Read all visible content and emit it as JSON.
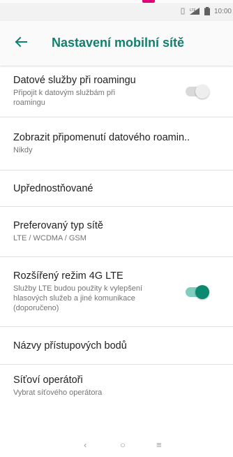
{
  "app": {
    "title": "Nastavení mobilní sítě"
  },
  "status": {
    "time": "10:00"
  },
  "colors": {
    "accent": "#11806e",
    "carrier_mark": "#e2007a"
  },
  "icons": {
    "back": "arrow-left-icon",
    "nav_back": "nav-back-icon",
    "nav_home": "nav-home-icon",
    "nav_recents": "nav-recents-icon"
  },
  "settings": {
    "data_roaming": {
      "title": "Datové služby při roamingu",
      "subtitle": "Připojit k datovým službám při roamingu",
      "enabled": false
    },
    "roaming_reminder": {
      "title": "Zobrazit připomenutí datového roamin..",
      "subtitle": "Nikdy"
    },
    "preferred": {
      "title": "Upřednostňované"
    },
    "network_type": {
      "title": "Preferovaný typ sítě",
      "subtitle": "LTE / WCDMA / GSM"
    },
    "enhanced_4g": {
      "title": "Rozšířený režim 4G LTE",
      "subtitle": "Služby LTE budou použity k vylepšení hlasových služeb a jiné komunikace (doporučeno)",
      "enabled": true
    },
    "apn": {
      "title": "Názvy přístupových bodů"
    },
    "operators": {
      "title": "Síťoví operátoři",
      "subtitle": "Vybrat síťového operátora"
    }
  },
  "navbar": {
    "back": "‹",
    "home": "○",
    "recents": "≡"
  }
}
